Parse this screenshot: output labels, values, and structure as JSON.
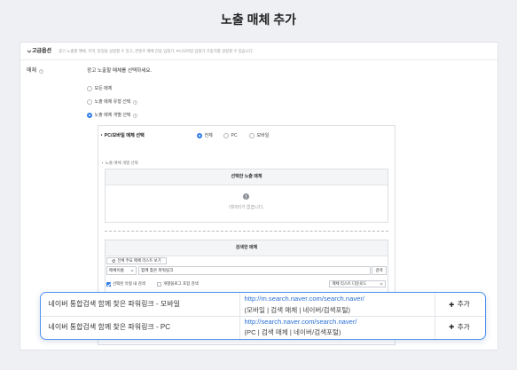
{
  "page": {
    "title": "노출 매체 추가"
  },
  "colors": {
    "accent": "#2f7bea",
    "link": "#2a6fd6",
    "highlight_border": "#4d94ee",
    "background": "#eef0f3"
  },
  "advanced": {
    "toggle_icon": "chevron-down-icon",
    "toggle_label": "고급옵션",
    "description": "광고 노출할 매체, 지역, 일정을 설정할 수 있고, 콘텐츠 매체 전용 입찰가, PC/모바일 입찰가 가중치를 설정할 수 있습니다."
  },
  "media": {
    "label": "매체",
    "help_icon": "help-icon",
    "prompt": "광고 노출할 매체를 선택하세요.",
    "options": [
      {
        "label": "모든 매체",
        "selected": false
      },
      {
        "label": "노출 매체 유형 선택",
        "selected": false
      },
      {
        "label": "노출 매체 개별 선택",
        "selected": true
      }
    ]
  },
  "device": {
    "label": "PC/모바일 매체 선택",
    "options": [
      {
        "label": "전체",
        "selected": true
      },
      {
        "label": "PC",
        "selected": false
      },
      {
        "label": "모바일",
        "selected": false
      }
    ]
  },
  "individual": {
    "label": "노출 매체 개별 선택",
    "selected_panel": {
      "title": "선택한 노출 매체",
      "empty_icon": "alert-circle-icon",
      "empty_text": "데이터가 없습니다."
    },
    "search_panel": {
      "title": "검색한 매체",
      "list_button": {
        "icon": "refresh-icon",
        "label": "전체 주요 매체 리스트 보기"
      },
      "search_field": "매체이름",
      "search_value": "함께 찾은 파워링크",
      "search_button": "검색",
      "filters": [
        {
          "label": "선택된 유형 내 검색",
          "checked": true
        },
        {
          "label": "개별블로그 포함 검색",
          "checked": false
        }
      ],
      "download_label": "매체 리스트 다운로드"
    }
  },
  "results": [
    {
      "name": "네이버 통합검색 함께 찾은 파워링크 - 모바일",
      "url": "http://m.search.naver.com/search.naver/",
      "meta": "(모바일 | 검색 매체 | 네이버/검색포털)",
      "action_icon": "plus-icon",
      "action": "추가"
    },
    {
      "name": "네이버 통합검색 함께 찾은 파워링크 - PC",
      "url": "http://search.naver.com/search.naver/",
      "meta": "(PC | 검색 매체 | 네이버/검색포털)",
      "action_icon": "plus-icon",
      "action": "추가"
    }
  ]
}
